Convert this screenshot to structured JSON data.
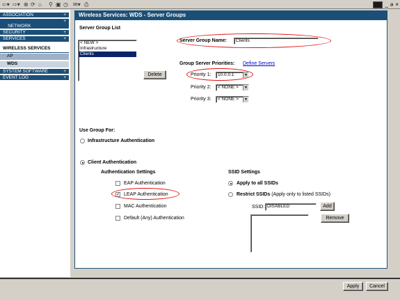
{
  "sidebar": {
    "items": [
      {
        "label": "ASSOCIATION",
        "expand": "+"
      },
      {
        "label": "NETWORK\nINTERFACES",
        "expand": "+"
      },
      {
        "label": "SECURITY",
        "expand": "+"
      },
      {
        "label": "SERVICES",
        "expand": "+"
      }
    ],
    "group": "WIRELESS SERVICES",
    "subitems": [
      "AP",
      "WDS"
    ],
    "bottom_items": [
      {
        "label": "SYSTEM SOFTWARE",
        "expand": "+"
      },
      {
        "label": "EVENT LOG",
        "expand": "+"
      }
    ]
  },
  "header": {
    "title": "Wireless Services: WDS - Server Groups"
  },
  "server_group_list": {
    "heading": "Server Group List",
    "items": [
      "< NEW >",
      "Infrastructure",
      "Clients"
    ],
    "selected": "Clients",
    "delete_label": "Delete"
  },
  "server_group_name": {
    "label": "Server Group Name:",
    "value": "Clients"
  },
  "priorities": {
    "heading": "Group Server Priorities:",
    "define_link": "Define Servers",
    "p1_label": "Priority 1:",
    "p1_value": "10.0.0.1",
    "p2_label": "Priority 2:",
    "p2_value": "< NONE >",
    "p3_label": "Priority 3:",
    "p3_value": "< NONE >"
  },
  "use_group": {
    "heading": "Use Group For:",
    "infra_label": "Infrastructure Authentication",
    "client_label": "Client Authentication"
  },
  "auth_settings": {
    "heading": "Authentication Settings",
    "eap": "EAP Authentication",
    "leap": "LEAP Authentication",
    "mac": "MAC Authentication",
    "default": "Default (Any) Authentication",
    "leap_checked": true
  },
  "ssid_settings": {
    "heading": "SSID Settings",
    "apply_all": "Apply to all SSIDs",
    "restrict_bold": "Restrict SSIDs",
    "restrict_rest": "(Apply only to listed SSIDs)",
    "ssid_label": "SSID:",
    "ssid_value": "DISABLED",
    "add_label": "Add",
    "remove_label": "Remove"
  },
  "footer": {
    "apply_label": "Apply",
    "cancel_label": "Cancel"
  },
  "colors": {
    "nav_blue": "#1c4f78",
    "highlight_red": "#d11111",
    "selection": "#0a246a"
  },
  "window_controls": {
    "minimize": "_",
    "restore": "ə",
    "close": "×"
  },
  "toolbar_icons": [
    "back-icon",
    "forward-icon",
    "stop-icon",
    "refresh-icon",
    "home-icon",
    "search-icon",
    "favorites-icon",
    "history-icon",
    "mail-icon",
    "print-icon"
  ]
}
